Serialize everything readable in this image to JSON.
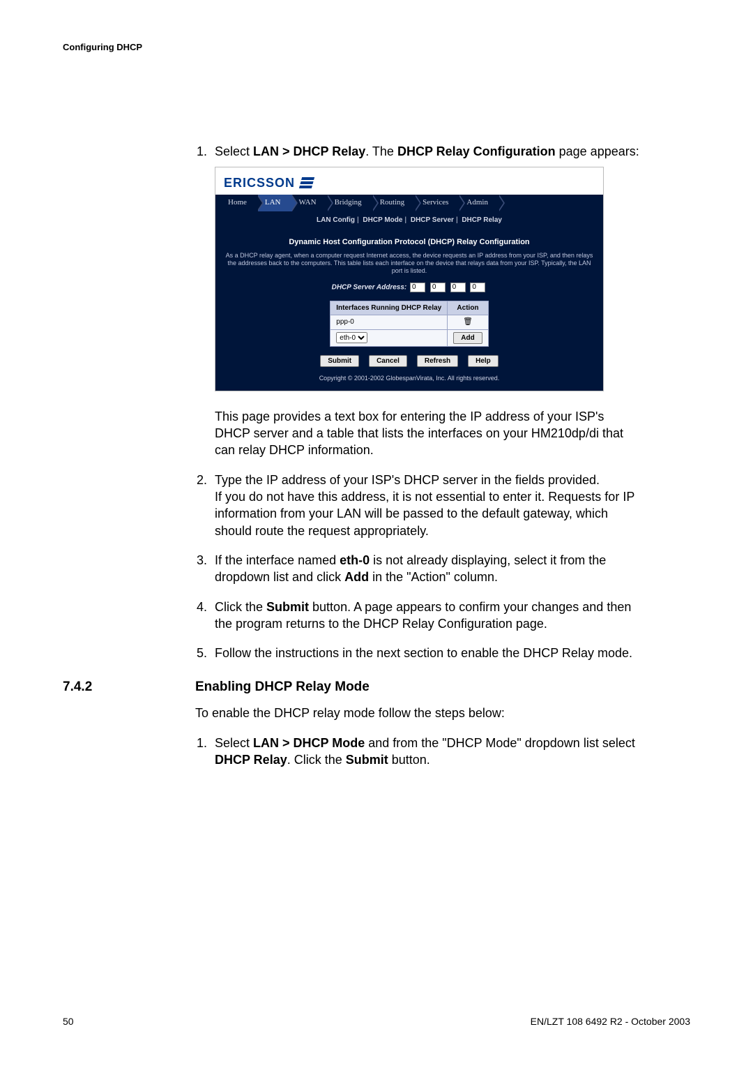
{
  "running_head": "Configuring DHCP",
  "step1": {
    "pre": "Select ",
    "bold1": "LAN > DHCP Relay",
    "mid": ". The ",
    "bold2": "DHCP Relay Configuration",
    "post": " page appears:"
  },
  "shot": {
    "logo": "ERICSSON",
    "nav": [
      "Home",
      "LAN",
      "WAN",
      "Bridging",
      "Routing",
      "Services",
      "Admin"
    ],
    "nav_active_index": 1,
    "subnav": [
      "LAN Config",
      "DHCP Mode",
      "DHCP Server",
      "DHCP Relay"
    ],
    "title": "Dynamic Host Configuration Protocol (DHCP) Relay Configuration",
    "desc": "As a DHCP relay agent, when a computer request Internet access, the device requests an IP address from your ISP, and then relays the addresses back to the computers. This table lists each interface on the device that relays data from your ISP. Typically, the LAN port is listed.",
    "addr_label": "DHCP Server Address:",
    "addr_values": [
      "0",
      "0",
      "0",
      "0"
    ],
    "table": {
      "col1": "Interfaces Running DHCP Relay",
      "col2": "Action",
      "row1_if": "ppp-0",
      "row2_if": "eth-0",
      "add_label": "Add"
    },
    "buttons": {
      "submit": "Submit",
      "cancel": "Cancel",
      "refresh": "Refresh",
      "help": "Help"
    },
    "copyright": "Copyright © 2001-2002 GlobespanVirata, Inc. All rights reserved."
  },
  "after_shot_para": "This page provides a text box for entering the IP address of your ISP's DHCP server and a table that lists the interfaces on your HM210dp/di that can relay DHCP information.",
  "step2_a": "Type the IP address of your ISP's DHCP server in the fields provided.",
  "step2_b": "If you do not have this address, it is not essential to enter it. Requests for IP information from your LAN will be passed to the default gateway, which should route the request appropriately.",
  "step3": {
    "pre": "If the interface named ",
    "bold1": "eth-0",
    "mid": " is not already displaying, select it from the dropdown list and click ",
    "bold2": "Add",
    "post": " in the \"Action\" column."
  },
  "step4": {
    "pre": "Click the ",
    "bold1": "Submit",
    "post": " button. A page appears to confirm your changes and then the program returns to the DHCP Relay Configuration page."
  },
  "step5": "Follow the instructions in the next section to enable the DHCP Relay mode.",
  "heading": {
    "num": "7.4.2",
    "text": "Enabling DHCP Relay Mode"
  },
  "heading_para": "To enable the DHCP relay mode follow the steps below:",
  "step742_1": {
    "pre": "Select ",
    "bold1": "LAN > DHCP Mode",
    "mid1": " and from the \"DHCP Mode\" dropdown list select ",
    "bold2": "DHCP Relay",
    "mid2": ". Click the ",
    "bold3": "Submit",
    "post": " button."
  },
  "footer": {
    "page": "50",
    "doc": "EN/LZT 108 6492 R2  -  October 2003"
  }
}
